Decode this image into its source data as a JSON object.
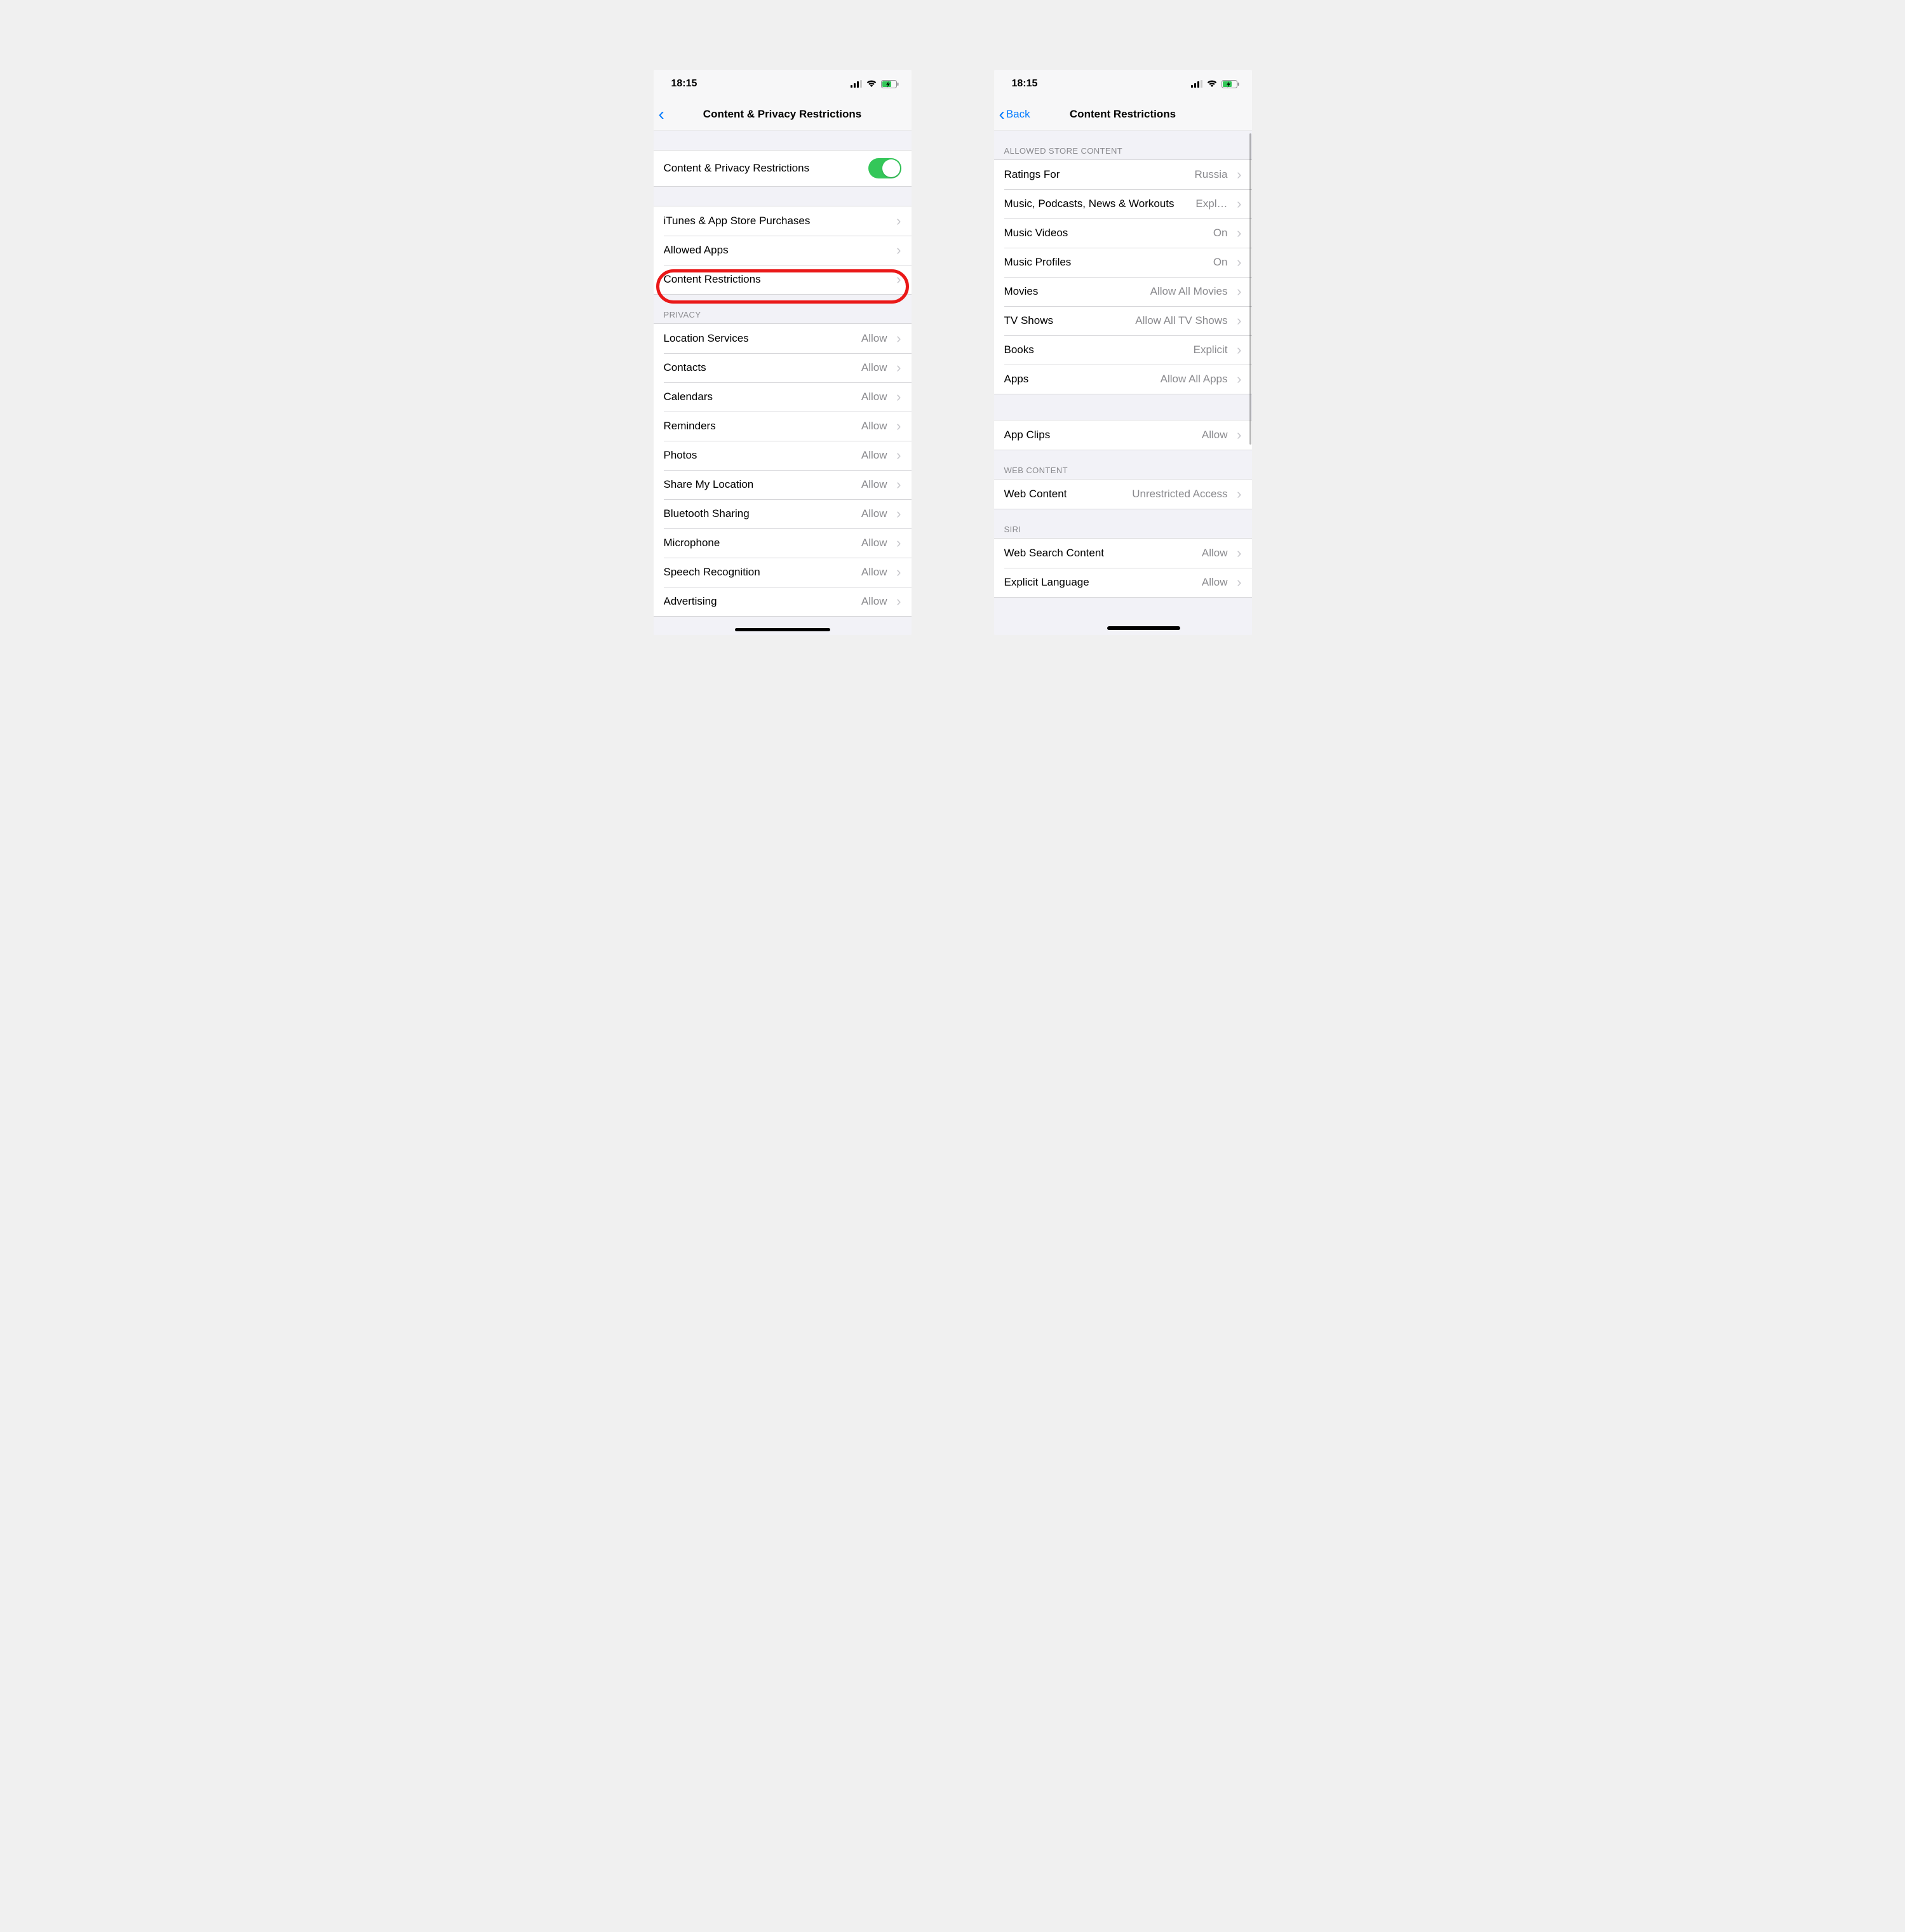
{
  "status_time": "18:15",
  "left": {
    "nav_title": "Content & Privacy Restrictions",
    "toggle_label": "Content & Privacy Restrictions",
    "main_rows": [
      {
        "label": "iTunes & App Store Purchases"
      },
      {
        "label": "Allowed Apps"
      },
      {
        "label": "Content Restrictions"
      }
    ],
    "privacy_header": "PRIVACY",
    "privacy_rows": [
      {
        "label": "Location Services",
        "value": "Allow"
      },
      {
        "label": "Contacts",
        "value": "Allow"
      },
      {
        "label": "Calendars",
        "value": "Allow"
      },
      {
        "label": "Reminders",
        "value": "Allow"
      },
      {
        "label": "Photos",
        "value": "Allow"
      },
      {
        "label": "Share My Location",
        "value": "Allow"
      },
      {
        "label": "Bluetooth Sharing",
        "value": "Allow"
      },
      {
        "label": "Microphone",
        "value": "Allow"
      },
      {
        "label": "Speech Recognition",
        "value": "Allow"
      },
      {
        "label": "Advertising",
        "value": "Allow"
      }
    ]
  },
  "right": {
    "nav_back": "Back",
    "nav_title": "Content Restrictions",
    "store_header": "ALLOWED STORE CONTENT",
    "store_rows": [
      {
        "label": "Ratings For",
        "value": "Russia"
      },
      {
        "label": "Music, Podcasts, News & Workouts",
        "value": "Expl…"
      },
      {
        "label": "Music Videos",
        "value": "On"
      },
      {
        "label": "Music Profiles",
        "value": "On"
      },
      {
        "label": "Movies",
        "value": "Allow All Movies"
      },
      {
        "label": "TV Shows",
        "value": "Allow All TV Shows"
      },
      {
        "label": "Books",
        "value": "Explicit"
      },
      {
        "label": "Apps",
        "value": "Allow All Apps"
      }
    ],
    "appclips_rows": [
      {
        "label": "App Clips",
        "value": "Allow"
      }
    ],
    "web_header": "WEB CONTENT",
    "web_rows": [
      {
        "label": "Web Content",
        "value": "Unrestricted Access"
      }
    ],
    "siri_header": "SIRI",
    "siri_rows": [
      {
        "label": "Web Search Content",
        "value": "Allow"
      },
      {
        "label": "Explicit Language",
        "value": "Allow"
      }
    ]
  }
}
